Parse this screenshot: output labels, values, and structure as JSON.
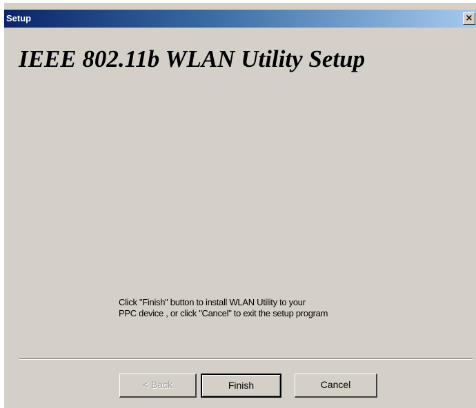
{
  "window": {
    "title": "Setup",
    "close_label": "×"
  },
  "main": {
    "heading": "IEEE 802.11b WLAN Utility Setup",
    "instructions": {
      "line1": "Click \"Finish\" button to install WLAN Utility to your",
      "line2": "PPC device , or click \"Cancel\" to exit the setup program"
    }
  },
  "buttons": {
    "back_label": "< Back",
    "back_enabled": false,
    "finish_label": "Finish",
    "cancel_label": "Cancel"
  },
  "colors": {
    "titlebar_start": "#0a246a",
    "titlebar_end": "#a6caf0",
    "dialog_face": "#d4d0c8"
  }
}
